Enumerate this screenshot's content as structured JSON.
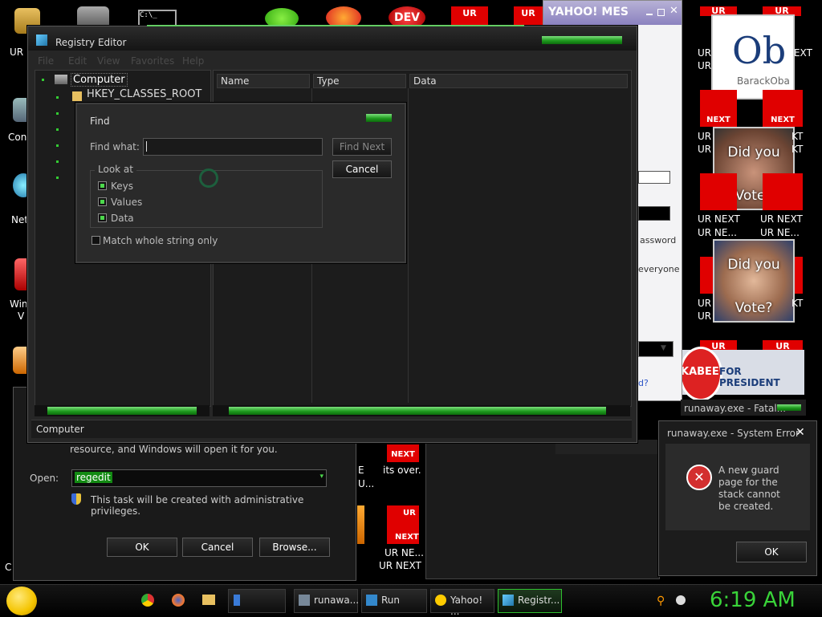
{
  "desktop": {
    "left_labels": [
      "UR",
      "Con",
      "Net",
      "Win",
      "V",
      "C"
    ],
    "ur_tile": "UR",
    "ur_next": "UR NEXT",
    "ur_ne": "UR NE...",
    "next": "NEXT",
    "right_label_pairs": [
      [
        "UR",
        "NEXT"
      ],
      [
        "UR",
        "KT"
      ],
      [
        "UR",
        "KT"
      ],
      [
        "UR",
        "KT"
      ]
    ],
    "obama_text": "Ob",
    "obama_sub": "BarackOba",
    "did_you": "Did you",
    "vote": "Vote?",
    "mid_e": "E",
    "mid_u": "U...",
    "its_over": "its over.",
    "huckabee": "KABEE",
    "for_president": "FOR PRESIDENT",
    "dev": "DEV"
  },
  "yahoo": {
    "title": "YAHOO! MES",
    "assword": "assword",
    "everyone": "everyone",
    "d": "d?"
  },
  "regedit": {
    "title": "Registry Editor",
    "menu": [
      "File",
      "Edit",
      "View",
      "Favorites",
      "Help"
    ],
    "tree_root": "Computer",
    "tree_first": "HKEY_CLASSES_ROOT",
    "col_name": "Name",
    "col_type": "Type",
    "col_data": "Data",
    "status": "Computer"
  },
  "find": {
    "title": "Find",
    "find_what_label": "Find what:",
    "find_what_value": "",
    "find_next": "Find Next",
    "cancel": "Cancel",
    "look_at": "Look at",
    "keys": "Keys",
    "values": "Values",
    "data": "Data",
    "match_whole": "Match whole string only"
  },
  "run": {
    "desc": "resource, and Windows will open it for you.",
    "open_label": "Open:",
    "open_value": "regedit",
    "admin_note": "This task will be created with administrative privileges.",
    "ok": "OK",
    "cancel": "Cancel",
    "browse": "Browse..."
  },
  "error": {
    "back_title": "runaway.exe - Fatal...",
    "title": "runaway.exe - System Error",
    "message": "A new guard page for the stack cannot be created.",
    "ok": "OK"
  },
  "taskbar": {
    "items": [
      "runawa...",
      "Run",
      "Yahoo! ...",
      "Registr..."
    ],
    "clock": "6:19 AM"
  },
  "colors": {
    "accent_green": "#2fbf2f",
    "clock": "#39d339",
    "tile_red": "#e00000"
  }
}
